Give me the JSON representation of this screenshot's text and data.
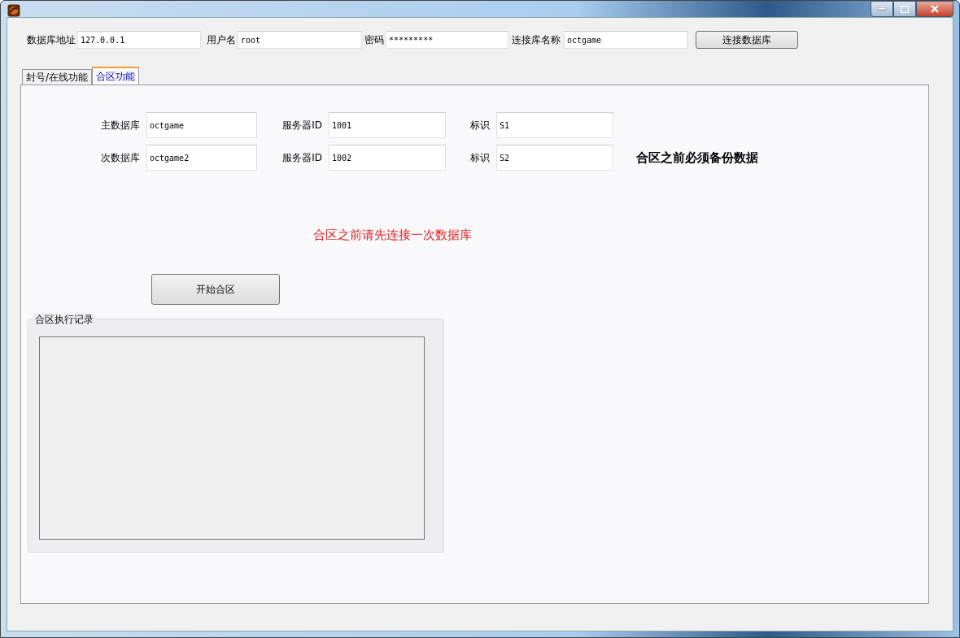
{
  "connection": {
    "fields": [
      {
        "label": "数据库地址",
        "value": "127.0.0.1"
      },
      {
        "label": "用户名",
        "value": "root"
      },
      {
        "label": "密码",
        "value": "*********"
      },
      {
        "label": "连接库名称",
        "value": "octgame"
      }
    ],
    "button": "连接数据库"
  },
  "tabs": [
    {
      "label": "封号/在线功能",
      "selected": false
    },
    {
      "label": "合区功能",
      "selected": true
    }
  ],
  "merge": {
    "rows": [
      {
        "db_label": "主数据库",
        "db": "octgame",
        "server_label": "服务器ID",
        "server_id": "1001",
        "tag_label": "标识",
        "tag": "S1"
      },
      {
        "db_label": "次数据库",
        "db": "octgame2",
        "server_label": "服务器ID",
        "server_id": "1002",
        "tag_label": "标识",
        "tag": "S2"
      }
    ],
    "backup_note": "合区之前必须备份数据",
    "warning": "合区之前请先连接一次数据库",
    "start_button": "开始合区",
    "log_title": "合区执行记录"
  }
}
